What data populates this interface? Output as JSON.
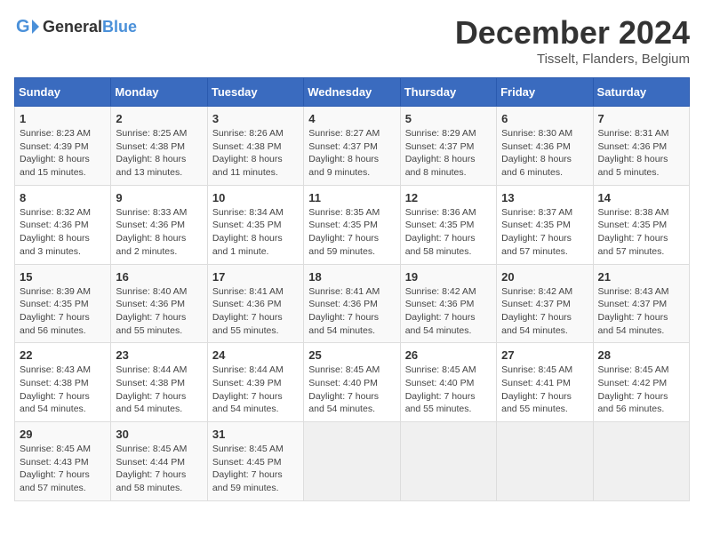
{
  "header": {
    "logo_general": "General",
    "logo_blue": "Blue",
    "month": "December 2024",
    "location": "Tisselt, Flanders, Belgium"
  },
  "weekdays": [
    "Sunday",
    "Monday",
    "Tuesday",
    "Wednesday",
    "Thursday",
    "Friday",
    "Saturday"
  ],
  "weeks": [
    [
      {
        "day": "1",
        "info": "Sunrise: 8:23 AM\nSunset: 4:39 PM\nDaylight: 8 hours\nand 15 minutes."
      },
      {
        "day": "2",
        "info": "Sunrise: 8:25 AM\nSunset: 4:38 PM\nDaylight: 8 hours\nand 13 minutes."
      },
      {
        "day": "3",
        "info": "Sunrise: 8:26 AM\nSunset: 4:38 PM\nDaylight: 8 hours\nand 11 minutes."
      },
      {
        "day": "4",
        "info": "Sunrise: 8:27 AM\nSunset: 4:37 PM\nDaylight: 8 hours\nand 9 minutes."
      },
      {
        "day": "5",
        "info": "Sunrise: 8:29 AM\nSunset: 4:37 PM\nDaylight: 8 hours\nand 8 minutes."
      },
      {
        "day": "6",
        "info": "Sunrise: 8:30 AM\nSunset: 4:36 PM\nDaylight: 8 hours\nand 6 minutes."
      },
      {
        "day": "7",
        "info": "Sunrise: 8:31 AM\nSunset: 4:36 PM\nDaylight: 8 hours\nand 5 minutes."
      }
    ],
    [
      {
        "day": "8",
        "info": "Sunrise: 8:32 AM\nSunset: 4:36 PM\nDaylight: 8 hours\nand 3 minutes."
      },
      {
        "day": "9",
        "info": "Sunrise: 8:33 AM\nSunset: 4:36 PM\nDaylight: 8 hours\nand 2 minutes."
      },
      {
        "day": "10",
        "info": "Sunrise: 8:34 AM\nSunset: 4:35 PM\nDaylight: 8 hours\nand 1 minute."
      },
      {
        "day": "11",
        "info": "Sunrise: 8:35 AM\nSunset: 4:35 PM\nDaylight: 7 hours\nand 59 minutes."
      },
      {
        "day": "12",
        "info": "Sunrise: 8:36 AM\nSunset: 4:35 PM\nDaylight: 7 hours\nand 58 minutes."
      },
      {
        "day": "13",
        "info": "Sunrise: 8:37 AM\nSunset: 4:35 PM\nDaylight: 7 hours\nand 57 minutes."
      },
      {
        "day": "14",
        "info": "Sunrise: 8:38 AM\nSunset: 4:35 PM\nDaylight: 7 hours\nand 57 minutes."
      }
    ],
    [
      {
        "day": "15",
        "info": "Sunrise: 8:39 AM\nSunset: 4:35 PM\nDaylight: 7 hours\nand 56 minutes."
      },
      {
        "day": "16",
        "info": "Sunrise: 8:40 AM\nSunset: 4:36 PM\nDaylight: 7 hours\nand 55 minutes."
      },
      {
        "day": "17",
        "info": "Sunrise: 8:41 AM\nSunset: 4:36 PM\nDaylight: 7 hours\nand 55 minutes."
      },
      {
        "day": "18",
        "info": "Sunrise: 8:41 AM\nSunset: 4:36 PM\nDaylight: 7 hours\nand 54 minutes."
      },
      {
        "day": "19",
        "info": "Sunrise: 8:42 AM\nSunset: 4:36 PM\nDaylight: 7 hours\nand 54 minutes."
      },
      {
        "day": "20",
        "info": "Sunrise: 8:42 AM\nSunset: 4:37 PM\nDaylight: 7 hours\nand 54 minutes."
      },
      {
        "day": "21",
        "info": "Sunrise: 8:43 AM\nSunset: 4:37 PM\nDaylight: 7 hours\nand 54 minutes."
      }
    ],
    [
      {
        "day": "22",
        "info": "Sunrise: 8:43 AM\nSunset: 4:38 PM\nDaylight: 7 hours\nand 54 minutes."
      },
      {
        "day": "23",
        "info": "Sunrise: 8:44 AM\nSunset: 4:38 PM\nDaylight: 7 hours\nand 54 minutes."
      },
      {
        "day": "24",
        "info": "Sunrise: 8:44 AM\nSunset: 4:39 PM\nDaylight: 7 hours\nand 54 minutes."
      },
      {
        "day": "25",
        "info": "Sunrise: 8:45 AM\nSunset: 4:40 PM\nDaylight: 7 hours\nand 54 minutes."
      },
      {
        "day": "26",
        "info": "Sunrise: 8:45 AM\nSunset: 4:40 PM\nDaylight: 7 hours\nand 55 minutes."
      },
      {
        "day": "27",
        "info": "Sunrise: 8:45 AM\nSunset: 4:41 PM\nDaylight: 7 hours\nand 55 minutes."
      },
      {
        "day": "28",
        "info": "Sunrise: 8:45 AM\nSunset: 4:42 PM\nDaylight: 7 hours\nand 56 minutes."
      }
    ],
    [
      {
        "day": "29",
        "info": "Sunrise: 8:45 AM\nSunset: 4:43 PM\nDaylight: 7 hours\nand 57 minutes."
      },
      {
        "day": "30",
        "info": "Sunrise: 8:45 AM\nSunset: 4:44 PM\nDaylight: 7 hours\nand 58 minutes."
      },
      {
        "day": "31",
        "info": "Sunrise: 8:45 AM\nSunset: 4:45 PM\nDaylight: 7 hours\nand 59 minutes."
      },
      {
        "day": "",
        "info": ""
      },
      {
        "day": "",
        "info": ""
      },
      {
        "day": "",
        "info": ""
      },
      {
        "day": "",
        "info": ""
      }
    ]
  ]
}
